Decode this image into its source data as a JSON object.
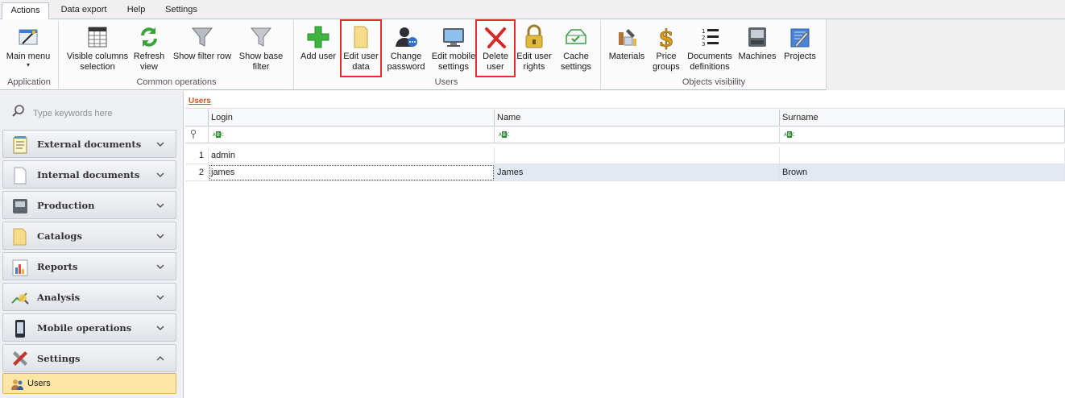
{
  "tabs": [
    "Actions",
    "Data export",
    "Help",
    "Settings"
  ],
  "ribbon": {
    "groups": {
      "application": "Application",
      "common": "Common operations",
      "users": "Users",
      "objects": "Objects visibility"
    },
    "buttons": {
      "main_menu": "Main menu",
      "visible_columns": "Visible columns\nselection",
      "refresh": "Refresh\nview",
      "show_filter_row": "Show filter row",
      "show_base_filter": "Show base\nfilter",
      "add_user": "Add user",
      "edit_user_data": "Edit user\ndata",
      "change_password": "Change\npassword",
      "edit_mobile": "Edit mobile\nsettings",
      "delete_user": "Delete\nuser",
      "edit_rights": "Edit user\nrights",
      "cache": "Cache\nsettings",
      "materials": "Materials",
      "price_groups": "Price\ngroups",
      "documents_definitions": "Documents\ndefinitions",
      "machines": "Machines",
      "projects": "Projects"
    }
  },
  "nav": {
    "search_placeholder": "Type keywords here",
    "items": [
      {
        "label": "External documents"
      },
      {
        "label": "Internal documents"
      },
      {
        "label": "Production"
      },
      {
        "label": "Catalogs"
      },
      {
        "label": "Reports"
      },
      {
        "label": "Analysis"
      },
      {
        "label": "Mobile operations"
      },
      {
        "label": "Settings"
      }
    ],
    "sub_selected": "Users"
  },
  "content": {
    "caption": "Users",
    "columns": [
      "Login",
      "Name",
      "Surname"
    ],
    "rows": [
      {
        "num": "1",
        "login": "admin",
        "name": "",
        "surname": ""
      },
      {
        "num": "2",
        "login": "james",
        "name": "James",
        "surname": "Brown"
      }
    ]
  }
}
